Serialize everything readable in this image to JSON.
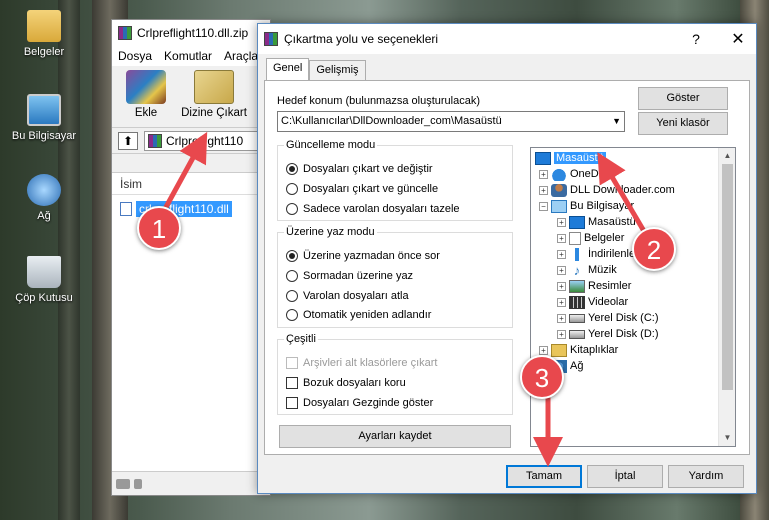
{
  "desktop": {
    "icons": [
      {
        "label": "Belgeler",
        "icon": "documents-folder-icon"
      },
      {
        "label": "Bu Bilgisayar",
        "icon": "this-pc-icon"
      },
      {
        "label": "Ağ",
        "icon": "network-icon"
      },
      {
        "label": "Çöp Kutusu",
        "icon": "recycle-bin-icon"
      }
    ]
  },
  "winrar": {
    "title": "Crlpreflight110.dll.zip",
    "menu": [
      "Dosya",
      "Komutlar",
      "Araçla"
    ],
    "tools": {
      "add": "Ekle",
      "extract": "Dizine Çıkart"
    },
    "path": "Crlpreflight110",
    "column": "İsim",
    "file": "crlpreflight110.dll"
  },
  "dialog": {
    "title": "Çıkartma yolu ve seçenekleri",
    "tabs": {
      "general": "Genel",
      "advanced": "Gelişmiş"
    },
    "dest_label": "Hedef konum (bulunmazsa oluşturulacak)",
    "dest_value": "C:\\Kullanıcılar\\DllDownloader_com\\Masaüstü",
    "show_button": "Göster",
    "new_folder_button": "Yeni klasör",
    "update_mode": {
      "legend": "Güncelleme modu",
      "options": [
        "Dosyaları çıkart ve değiştir",
        "Dosyaları çıkart ve güncelle",
        "Sadece varolan dosyaları tazele"
      ],
      "selected": 0
    },
    "overwrite_mode": {
      "legend": "Üzerine yaz modu",
      "options": [
        "Üzerine yazmadan önce sor",
        "Sormadan üzerine yaz",
        "Varolan dosyaları atla",
        "Otomatik yeniden adlandır"
      ],
      "selected": 0
    },
    "misc": {
      "legend": "Çeşitli",
      "options": [
        "Arşivleri alt klasörlere çıkart",
        "Bozuk dosyaları koru",
        "Dosyaları Gezginde göster"
      ]
    },
    "save_button": "Ayarları kaydet",
    "tree": [
      {
        "label": "Masaüstü",
        "icon": "desktop-icon",
        "selected": true
      },
      {
        "label": "OneDrive",
        "icon": "onedrive-icon"
      },
      {
        "label": "DLL Downloader.com",
        "icon": "user-icon"
      },
      {
        "label": "Bu Bilgisayar",
        "icon": "this-pc-icon"
      },
      {
        "label": "Masaüstü",
        "icon": "desktop-icon"
      },
      {
        "label": "Belgeler",
        "icon": "documents-icon"
      },
      {
        "label": "İndirilenler",
        "icon": "downloads-icon"
      },
      {
        "label": "Müzik",
        "icon": "music-icon"
      },
      {
        "label": "Resimler",
        "icon": "pictures-icon"
      },
      {
        "label": "Videolar",
        "icon": "videos-icon"
      },
      {
        "label": "Yerel Disk (C:)",
        "icon": "disk-icon"
      },
      {
        "label": "Yerel Disk (D:)",
        "icon": "disk-icon"
      },
      {
        "label": "Kitaplıklar",
        "icon": "libraries-icon"
      },
      {
        "label": "Ağ",
        "icon": "network-icon"
      }
    ],
    "buttons": {
      "ok": "Tamam",
      "cancel": "İptal",
      "help": "Yardım"
    }
  },
  "annotations": {
    "badges": [
      "1",
      "2",
      "3"
    ],
    "color": "#e8484d"
  }
}
